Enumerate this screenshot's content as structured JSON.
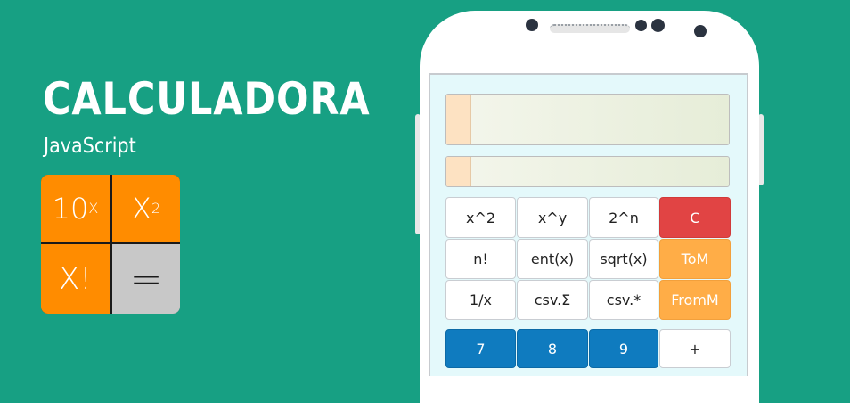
{
  "branding": {
    "title": "CALCULADORA",
    "subtitle": "JavaScript",
    "logo": {
      "tile_10x_base": "10",
      "tile_10x_exp": "X",
      "tile_x2_base": "X",
      "tile_x2_exp": "2",
      "tile_factorial": "X!",
      "tile_equals": "="
    }
  },
  "calculator": {
    "display_main": "",
    "display_secondary": "",
    "keys": {
      "row1": [
        "x^2",
        "x^y",
        "2^n",
        "C"
      ],
      "row2": [
        "n!",
        "ent(x)",
        "sqrt(x)",
        "ToM"
      ],
      "row3": [
        "1/x",
        "csv.Σ",
        "csv.*",
        "FromM"
      ],
      "row4": [
        "7",
        "8",
        "9",
        "+"
      ]
    }
  },
  "colors": {
    "background": "#17a083",
    "tile_orange": "#ff8c00",
    "tile_gray": "#c8c8c8",
    "key_clear": "#e14444",
    "key_memory": "#ffad47",
    "key_digit": "#0f7bbf"
  }
}
